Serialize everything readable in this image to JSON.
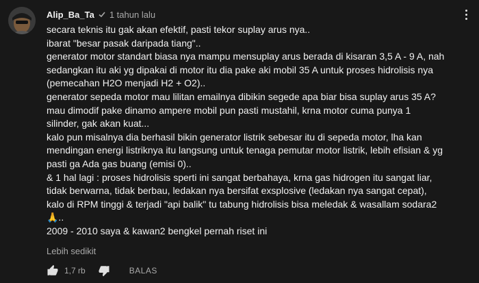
{
  "comment": {
    "author": "Alip_Ba_Ta",
    "separator": "✓",
    "time": "1 tahun lalu",
    "lines": [
      "secara teknis itu gak akan efektif, pasti tekor suplay arus nya..",
      "ibarat \"besar pasak daripada tiang\"..",
      "generator motor standart biasa nya mampu mensuplay arus berada di kisaran 3,5 A - 9 A, nah",
      "sedangkan itu aki yg dipakai di motor itu dia pake aki mobil 35 A untuk proses hidrolisis nya",
      "(pemecahan H2O menjadi H2 + O2)..",
      "generator sepeda motor mau lilitan emailnya dibikin segede apa biar bisa suplay arus 35 A?",
      "mau dimodif pake dinamo ampere mobil pun pasti mustahil, krna motor cuma punya 1",
      "silinder, gak akan kuat...",
      "kalo pun misalnya dia berhasil bikin generator listrik sebesar itu di sepeda motor, lha kan",
      "mendingan energi listriknya itu langsung untuk tenaga pemutar motor listrik, lebih efisian & yg",
      "pasti ga Ada gas buang (emisi 0)..",
      "& 1 hal lagi : proses hidrolisis sperti ini sangat berbahaya, krna gas hidrogen itu sangat liar,",
      "tidak berwarna, tidak berbau, ledakan nya bersifat exsplosive (ledakan nya sangat cepat),",
      "kalo di RPM tinggi & terjadi \"api balik\" tu tabung hidrolisis bisa meledak & wasallam sodara2",
      "🙏..",
      "2009 - 2010 saya & kawan2 bengkel pernah riset ini"
    ],
    "show_less_label": "Lebih sedikit",
    "like_count": "1,7 rb",
    "reply_label": "BALAS"
  },
  "icons": {
    "avatar": "avatar",
    "verified": "check-icon",
    "menu": "more-vertical-icon",
    "like": "thumbs-up-icon",
    "dislike": "thumbs-down-icon"
  },
  "colors": {
    "background": "#181818",
    "text_primary": "#f1f1f1",
    "text_secondary": "#aaaaaa"
  }
}
